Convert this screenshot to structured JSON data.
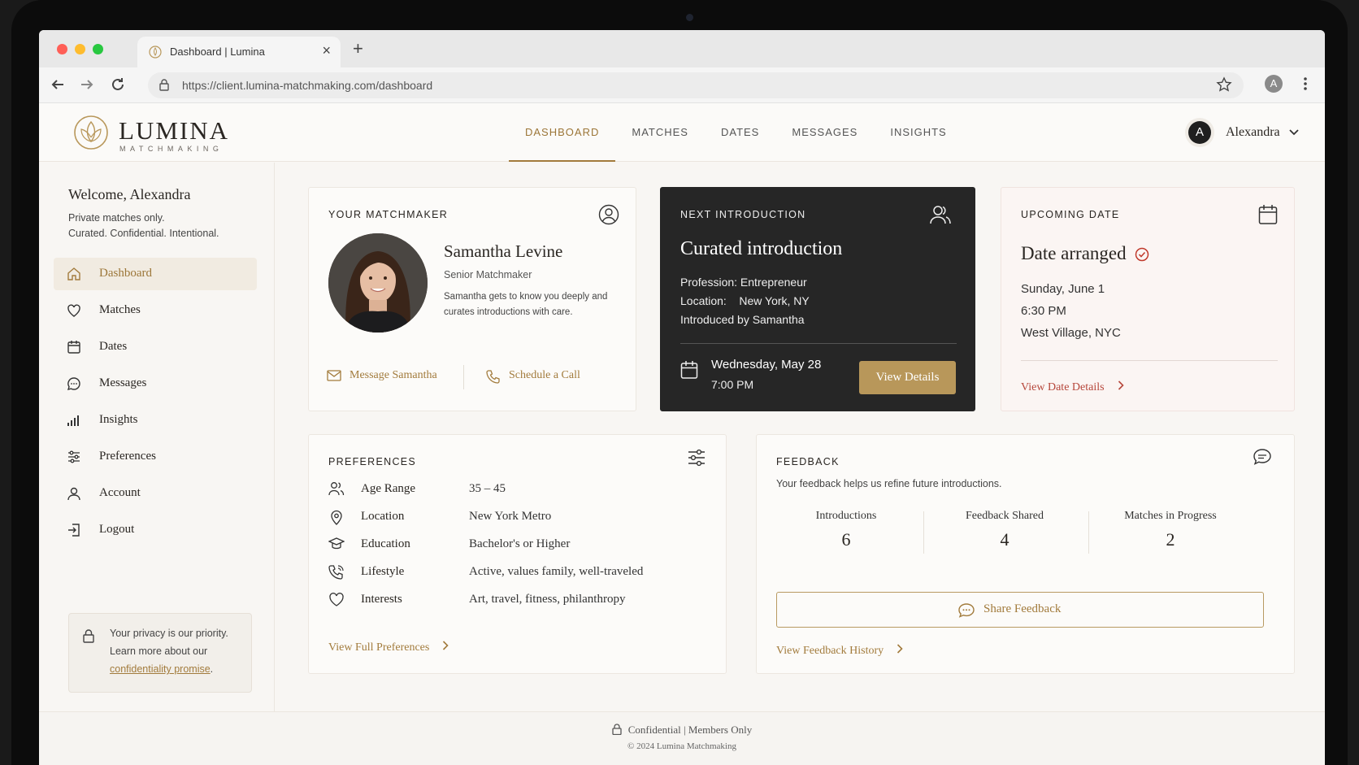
{
  "browser": {
    "tab_title": "Dashboard | Lumina",
    "url": "https://client.lumina-matchmaking.com/dashboard",
    "profile_initial": "A",
    "traffic_colors": [
      "#ff5f57",
      "#febc2e",
      "#28c840"
    ]
  },
  "brand": {
    "name": "LUMINA",
    "subtitle": "MATCHMAKING",
    "accent": "#a27b3c"
  },
  "topnav": [
    {
      "label": "DASHBOARD",
      "active": true
    },
    {
      "label": "MATCHES",
      "active": false
    },
    {
      "label": "DATES",
      "active": false
    },
    {
      "label": "MESSAGES",
      "active": false
    },
    {
      "label": "INSIGHTS",
      "active": false
    }
  ],
  "user": {
    "initial": "A",
    "name": "Alexandra"
  },
  "sidebar": {
    "welcome": "Welcome, Alexandra",
    "tagline1": "Private matches only.",
    "tagline2": "Curated. Confidential. Intentional.",
    "items": [
      {
        "label": "Dashboard",
        "icon": "home-icon"
      },
      {
        "label": "Matches",
        "icon": "heart-icon"
      },
      {
        "label": "Dates",
        "icon": "calendar-icon"
      },
      {
        "label": "Messages",
        "icon": "chat-icon"
      },
      {
        "label": "Insights",
        "icon": "bar-chart-icon"
      },
      {
        "label": "Preferences",
        "icon": "sliders-icon"
      },
      {
        "label": "Account",
        "icon": "person-icon"
      },
      {
        "label": "Logout",
        "icon": "logout-icon"
      }
    ],
    "privacy": {
      "line1": "Your privacy is our priority.",
      "line2": "Learn more about our",
      "link": "confidentiality promise",
      "end": "."
    }
  },
  "matchmaker": {
    "label": "YOUR MATCHMAKER",
    "name": "Samantha Levine",
    "role": "Senior Matchmaker",
    "desc1": "Samantha gets to know you deeply and",
    "desc2": "curates introductions with care.",
    "message_label": "Message Samantha",
    "call_label": "Schedule a Call"
  },
  "intro": {
    "label": "NEXT INTRODUCTION",
    "title": "Curated introduction",
    "profession": "Profession: Entrepreneur",
    "location": "Location:    New York, NY",
    "by": "Introduced by Samantha",
    "date": "Wednesday, May 28",
    "time": "7:00 PM",
    "button": "View Details"
  },
  "date": {
    "label": "UPCOMING DATE",
    "title": "Date arranged",
    "day": "Sunday, June 1",
    "time": "6:30 PM",
    "place": "West Village, NYC",
    "link": "View Date Details"
  },
  "preferences": {
    "label": "PREFERENCES",
    "rows": [
      {
        "key": "Age Range",
        "value": "35 – 45",
        "icon": "people-icon"
      },
      {
        "key": "Location",
        "value": "New York Metro",
        "icon": "pin-icon"
      },
      {
        "key": "Education",
        "value": "Bachelor's or Higher",
        "icon": "graduation-cap-icon"
      },
      {
        "key": "Lifestyle",
        "value": "Active, values family, well-traveled",
        "icon": "phone-icon"
      },
      {
        "key": "Interests",
        "value": "Art, travel, fitness, philanthropy",
        "icon": "heart-icon"
      }
    ],
    "link": "View Full Preferences"
  },
  "feedback": {
    "label": "FEEDBACK",
    "subtitle": "Your feedback helps us refine future introductions.",
    "stats": [
      {
        "label": "Introductions",
        "value": "6"
      },
      {
        "label": "Feedback Shared",
        "value": "4"
      },
      {
        "label": "Matches in Progress",
        "value": "2"
      }
    ],
    "button": "Share Feedback",
    "link": "View Feedback History"
  },
  "footer": {
    "line1": "Confidential | Members Only",
    "line2": "© 2024 Lumina Matchmaking"
  }
}
